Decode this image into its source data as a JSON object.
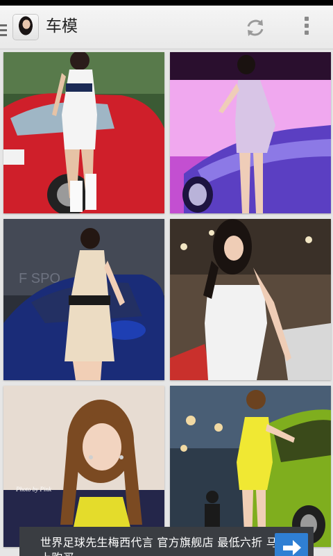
{
  "app": {
    "title": "车模",
    "icons": {
      "up": "up-indicator-icon",
      "app": "app-icon",
      "refresh": "refresh-icon",
      "overflow": "overflow-menu-icon"
    }
  },
  "gallery": {
    "items": [
      {
        "name": "photo-1",
        "caption": ""
      },
      {
        "name": "photo-2",
        "caption": ""
      },
      {
        "name": "photo-3",
        "caption": "F SPO"
      },
      {
        "name": "photo-4",
        "caption": ""
      },
      {
        "name": "photo-5",
        "caption": "Photo by Pink"
      },
      {
        "name": "photo-6",
        "caption": ""
      }
    ]
  },
  "ad": {
    "text": "世界足球先生梅西代言 官方旗舰店 最低六折 马上购买",
    "button_icon": "arrow-right-icon",
    "button_color": "#2f7fd3"
  },
  "colors": {
    "actionbar": "#efefef",
    "statusbar": "#000000",
    "background": "#e6e6e6"
  }
}
